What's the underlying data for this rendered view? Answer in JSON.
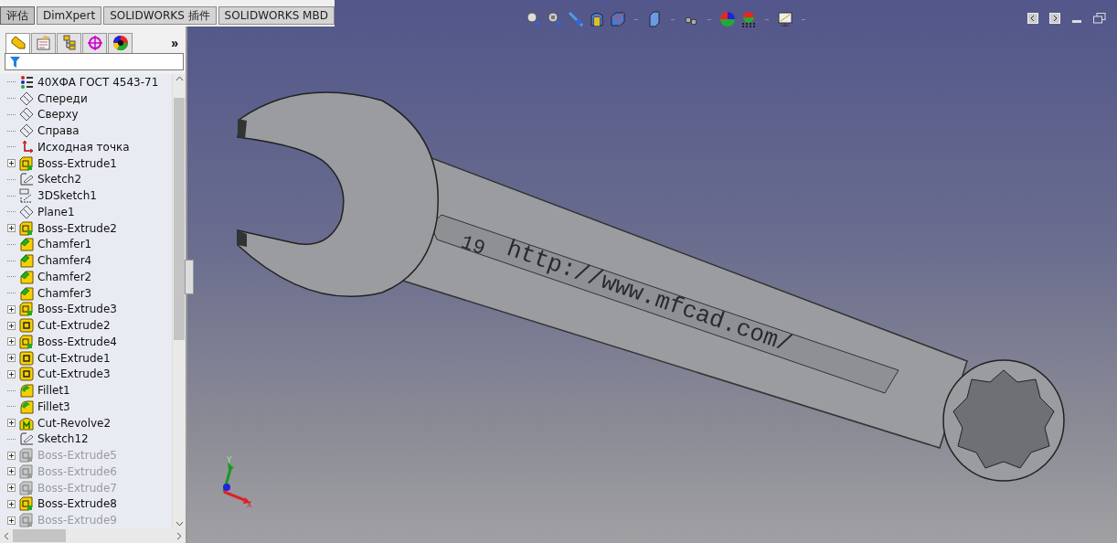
{
  "command_tabs": [
    {
      "label": "评估",
      "selected": true
    },
    {
      "label": "DimXpert",
      "selected": false
    },
    {
      "label": "SOLIDWORKS 插件",
      "selected": false
    },
    {
      "label": "SOLIDWORKS MBD",
      "selected": false
    }
  ],
  "manager_tabs": [
    {
      "kind": "feature",
      "selected": true
    },
    {
      "kind": "property",
      "selected": false
    },
    {
      "kind": "config",
      "selected": false
    },
    {
      "kind": "dimxpert",
      "selected": false
    },
    {
      "kind": "display",
      "selected": false
    }
  ],
  "more_label": "»",
  "feature_tree": [
    {
      "label": "40ХФА ГОСТ 4543-71",
      "kind": "material",
      "expandable": false,
      "suppressed": false
    },
    {
      "label": "Спереди",
      "kind": "plane",
      "expandable": false,
      "suppressed": false
    },
    {
      "label": "Сверху",
      "kind": "plane",
      "expandable": false,
      "suppressed": false
    },
    {
      "label": "Справа",
      "kind": "plane",
      "expandable": false,
      "suppressed": false
    },
    {
      "label": "Исходная точка",
      "kind": "origin",
      "expandable": false,
      "suppressed": false
    },
    {
      "label": "Boss-Extrude1",
      "kind": "boss",
      "expandable": true,
      "suppressed": false
    },
    {
      "label": "Sketch2",
      "kind": "sketch",
      "expandable": false,
      "suppressed": false
    },
    {
      "label": "3DSketch1",
      "kind": "sketch3d",
      "expandable": false,
      "suppressed": false
    },
    {
      "label": "Plane1",
      "kind": "plane",
      "expandable": false,
      "suppressed": false
    },
    {
      "label": "Boss-Extrude2",
      "kind": "boss",
      "expandable": true,
      "suppressed": false
    },
    {
      "label": "Chamfer1",
      "kind": "chamfer",
      "expandable": false,
      "suppressed": false
    },
    {
      "label": "Chamfer4",
      "kind": "chamfer",
      "expandable": false,
      "suppressed": false
    },
    {
      "label": "Chamfer2",
      "kind": "chamfer",
      "expandable": false,
      "suppressed": false
    },
    {
      "label": "Chamfer3",
      "kind": "chamfer",
      "expandable": false,
      "suppressed": false
    },
    {
      "label": "Boss-Extrude3",
      "kind": "boss",
      "expandable": true,
      "suppressed": false
    },
    {
      "label": "Cut-Extrude2",
      "kind": "cut",
      "expandable": true,
      "suppressed": false
    },
    {
      "label": "Boss-Extrude4",
      "kind": "boss",
      "expandable": true,
      "suppressed": false
    },
    {
      "label": "Cut-Extrude1",
      "kind": "cut",
      "expandable": true,
      "suppressed": false
    },
    {
      "label": "Cut-Extrude3",
      "kind": "cut",
      "expandable": true,
      "suppressed": false
    },
    {
      "label": "Fillet1",
      "kind": "fillet",
      "expandable": false,
      "suppressed": false
    },
    {
      "label": "Fillet3",
      "kind": "fillet",
      "expandable": false,
      "suppressed": false
    },
    {
      "label": "Cut-Revolve2",
      "kind": "revolve",
      "expandable": true,
      "suppressed": false
    },
    {
      "label": "Sketch12",
      "kind": "sketch",
      "expandable": false,
      "suppressed": false
    },
    {
      "label": "Boss-Extrude5",
      "kind": "boss",
      "expandable": true,
      "suppressed": true
    },
    {
      "label": "Boss-Extrude6",
      "kind": "boss",
      "expandable": true,
      "suppressed": true
    },
    {
      "label": "Boss-Extrude7",
      "kind": "boss",
      "expandable": true,
      "suppressed": true
    },
    {
      "label": "Boss-Extrude8",
      "kind": "boss",
      "expandable": true,
      "suppressed": false
    },
    {
      "label": "Boss-Extrude9",
      "kind": "boss",
      "expandable": true,
      "suppressed": true
    }
  ],
  "viewport": {
    "engraving_size": "19",
    "engraving_url": "http://www.mfcad.com/",
    "axis_labels": [
      "Y",
      "X"
    ]
  }
}
